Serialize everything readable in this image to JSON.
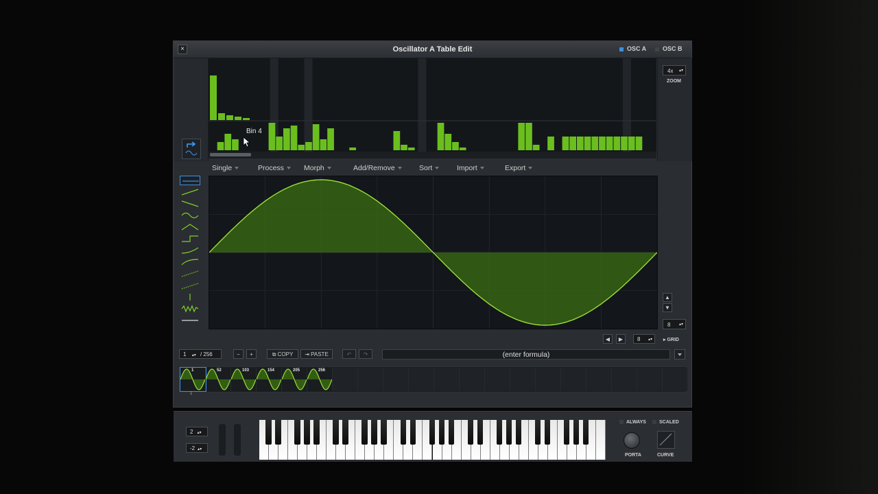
{
  "window": {
    "title": "Oscillator A Table Edit",
    "close_glyph": "×"
  },
  "osc_tabs": [
    {
      "label": "OSC A",
      "active": true
    },
    {
      "label": "OSC B",
      "active": false
    }
  ],
  "zoom": {
    "value": "4x",
    "label": "ZOOM"
  },
  "spectrum": {
    "tooltip": "Bin 4",
    "top_bars": [
      {
        "bin": 1,
        "level": 0.65
      },
      {
        "bin": 2,
        "level": 0.1
      },
      {
        "bin": 3,
        "level": 0.07
      },
      {
        "bin": 4,
        "level": 0.05
      },
      {
        "bin": 5,
        "level": 0.03
      }
    ],
    "bottom_bars": [
      0,
      0.3,
      0.6,
      0.4,
      0,
      0,
      0,
      0,
      1,
      0.5,
      0.8,
      0.9,
      0.2,
      0.3,
      0.95,
      0.4,
      0.8,
      0,
      0,
      0.1,
      0,
      0,
      0,
      0,
      0,
      0.7,
      0.2,
      0.1,
      0,
      0,
      0,
      1,
      0.6,
      0.3,
      0.1,
      0,
      0,
      0,
      0,
      0,
      0,
      0,
      1,
      1,
      0.2,
      0,
      0.5,
      0,
      0.5,
      0.5,
      0.5,
      0.5,
      0.5,
      0.5,
      0.5,
      0.5,
      0.5,
      0.5,
      0.5
    ],
    "highlight_bins": [
      4,
      7,
      17,
      35
    ]
  },
  "menu": [
    {
      "label": "Single"
    },
    {
      "label": "Process"
    },
    {
      "label": "Morph"
    },
    {
      "label": "Add/Remove"
    },
    {
      "label": "Sort"
    },
    {
      "label": "Import"
    },
    {
      "label": "Export"
    }
  ],
  "shape_tools": [
    "flat-line-shape",
    "saw-up-shape",
    "saw-down-shape",
    "sine-shape",
    "triangle-shape",
    "sawtooth-shape",
    "square-shape",
    "ramp-shape",
    "dotted-ramp-shape",
    "dotted-up-shape",
    "up-down-shape",
    "noise-shape",
    "expand-shape"
  ],
  "editor": {
    "waveform": "sine",
    "cycles": 1,
    "grid_divisions": 8,
    "color": "#6abf1e"
  },
  "grid": {
    "value": "8",
    "label": "GRID",
    "snap_value": "8"
  },
  "frame_nav": {
    "current": "1",
    "total": "/ 256"
  },
  "buttons": {
    "minus": "−",
    "plus": "+",
    "copy": "COPY",
    "paste": "PASTE",
    "undo": "↶",
    "redo": "↷"
  },
  "formula": {
    "placeholder": "(enter formula)"
  },
  "frames": [
    {
      "label": "1"
    },
    {
      "label": "52"
    },
    {
      "label": "103"
    },
    {
      "label": "154"
    },
    {
      "label": "205"
    },
    {
      "label": "256"
    }
  ],
  "frame_marker": "1",
  "bottom": {
    "pitch_up": "2",
    "pitch_down": "-2",
    "always": "ALWAYS",
    "scaled": "SCALED",
    "porta": "PORTA",
    "curve": "CURVE"
  },
  "colors": {
    "accent": "#3f8fe0",
    "wave": "#6abf1e",
    "bg": "#2a2d31"
  }
}
